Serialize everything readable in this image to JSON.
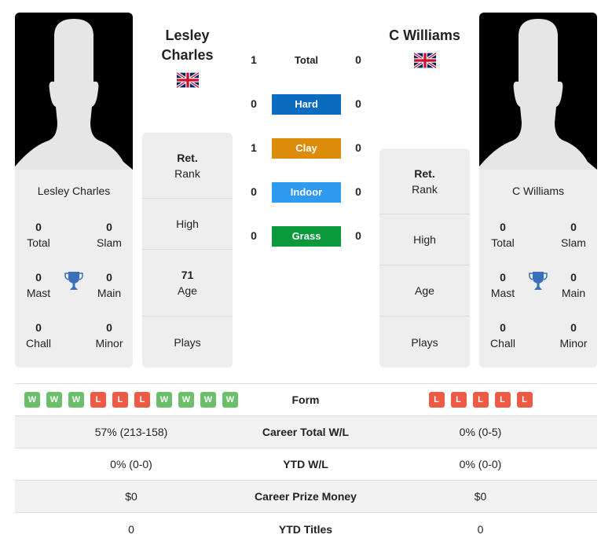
{
  "players": [
    {
      "name_line1": "Lesley",
      "name_line2": "Charles",
      "card_name": "Lesley Charles",
      "country": "gb-flag-icon",
      "titles": {
        "total": {
          "value": "0",
          "label": "Total"
        },
        "slam": {
          "value": "0",
          "label": "Slam"
        },
        "mast": {
          "value": "0",
          "label": "Mast"
        },
        "main": {
          "value": "0",
          "label": "Main"
        },
        "chall": {
          "value": "0",
          "label": "Chall"
        },
        "minor": {
          "value": "0",
          "label": "Minor"
        }
      },
      "rank": {
        "value": "Ret.",
        "label": "Rank"
      },
      "high": {
        "value": "",
        "label": "High"
      },
      "age": {
        "value": "71",
        "label": "Age"
      },
      "plays": {
        "value": "",
        "label": "Plays"
      }
    },
    {
      "name_line1": "C Williams",
      "name_line2": "",
      "card_name": "C Williams",
      "country": "gb-flag-icon",
      "titles": {
        "total": {
          "value": "0",
          "label": "Total"
        },
        "slam": {
          "value": "0",
          "label": "Slam"
        },
        "mast": {
          "value": "0",
          "label": "Mast"
        },
        "main": {
          "value": "0",
          "label": "Main"
        },
        "chall": {
          "value": "0",
          "label": "Chall"
        },
        "minor": {
          "value": "0",
          "label": "Minor"
        }
      },
      "rank": {
        "value": "Ret.",
        "label": "Rank"
      },
      "high": {
        "value": "",
        "label": "High"
      },
      "age": {
        "value": "",
        "label": "Age"
      },
      "plays": {
        "value": "",
        "label": "Plays"
      }
    }
  ],
  "h2h": [
    {
      "label": "Total",
      "left": "1",
      "right": "0",
      "color": ""
    },
    {
      "label": "Hard",
      "left": "0",
      "right": "0",
      "color": "#0a6bbf"
    },
    {
      "label": "Clay",
      "left": "1",
      "right": "0",
      "color": "#dd8c0a"
    },
    {
      "label": "Indoor",
      "left": "0",
      "right": "0",
      "color": "#2f9bf0"
    },
    {
      "label": "Grass",
      "left": "0",
      "right": "0",
      "color": "#0a9a3c"
    }
  ],
  "form": {
    "label": "Form",
    "left": [
      "W",
      "W",
      "W",
      "L",
      "L",
      "L",
      "W",
      "W",
      "W",
      "W"
    ],
    "right": [
      "L",
      "L",
      "L",
      "L",
      "L"
    ]
  },
  "stats": [
    {
      "label": "Career Total W/L",
      "left": "57% (213-158)",
      "right": "0% (0-5)"
    },
    {
      "label": "YTD W/L",
      "left": "0% (0-0)",
      "right": "0% (0-0)"
    },
    {
      "label": "Career Prize Money",
      "left": "$0",
      "right": "$0"
    },
    {
      "label": "YTD Titles",
      "left": "0",
      "right": "0"
    }
  ],
  "colors": {
    "win": "#6bbf6b",
    "loss": "#ee5b45",
    "trophy": "#3a6fba"
  }
}
